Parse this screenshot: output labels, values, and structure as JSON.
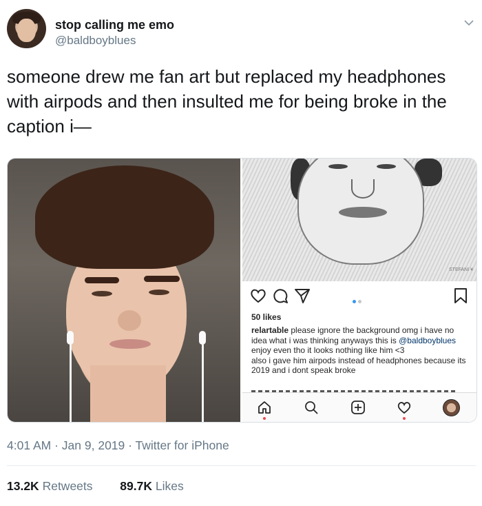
{
  "tweet": {
    "display_name": "stop calling me emo",
    "handle": "@baldboyblues",
    "text": "someone drew me fan art but replaced my headphones with airpods and then insulted me for being broke in the caption i—",
    "time": "4:01 AM",
    "date": "Jan 9, 2019",
    "source": "Twitter for iPhone",
    "retweets_count": "13.2K",
    "retweets_label": "Retweets",
    "likes_count": "89.7K",
    "likes_label": "Likes",
    "separator": "·"
  },
  "instagram": {
    "likes": "50 likes",
    "caption_user": "relartable",
    "caption_text_1": "please ignore the background omg i have no idea what i was thinking anyways this is",
    "caption_mention": "@baldboyblues",
    "caption_text_2": "enjoy even tho it looks nothing like him <3",
    "caption_text_3": "also i gave him airpods instead of headphones because its 2019 and i dont speak broke",
    "signature": "STEFANI ¥"
  },
  "colors": {
    "text": "#14171a",
    "secondary": "#657786",
    "ig_blue": "#003569",
    "ig_dot_active": "#3897f0",
    "ig_red": "#ed4956"
  }
}
